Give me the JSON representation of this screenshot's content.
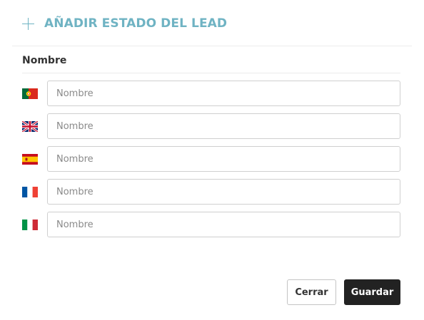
{
  "dialog": {
    "title": "AÑADIR ESTADO DEL LEAD",
    "section_label": "Nombre",
    "fields": [
      {
        "language": "pt",
        "flag": "portugal-flag-icon",
        "value": "",
        "placeholder": "Nombre"
      },
      {
        "language": "en",
        "flag": "united-kingdom-flag-icon",
        "value": "",
        "placeholder": "Nombre"
      },
      {
        "language": "es",
        "flag": "spain-flag-icon",
        "value": "",
        "placeholder": "Nombre"
      },
      {
        "language": "fr",
        "flag": "france-flag-icon",
        "value": "",
        "placeholder": "Nombre"
      },
      {
        "language": "it",
        "flag": "italy-flag-icon",
        "value": "",
        "placeholder": "Nombre"
      }
    ],
    "buttons": {
      "close_label": "Cerrar",
      "save_label": "Guardar"
    }
  },
  "colors": {
    "accent": "#6fb3c3",
    "primary_button": "#222222"
  }
}
